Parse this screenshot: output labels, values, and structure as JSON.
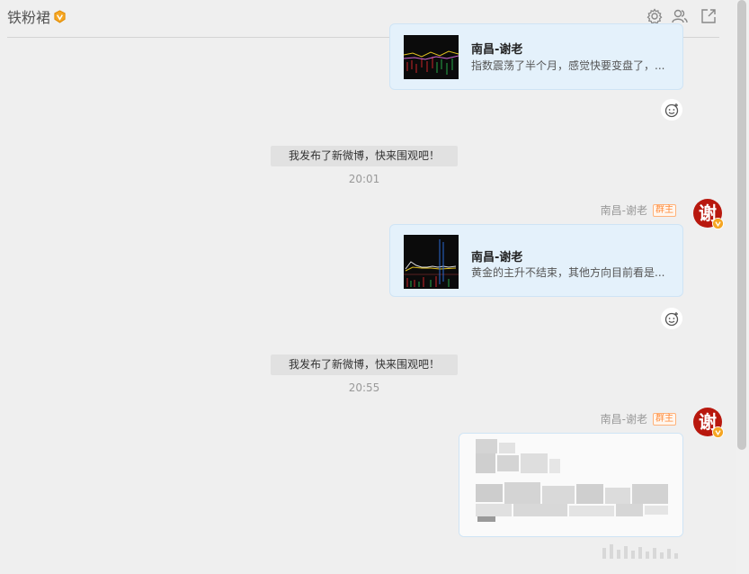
{
  "header": {
    "title": "铁粉裙",
    "icons": [
      "vip-badge-icon",
      "gear-icon",
      "members-icon",
      "external-link-icon"
    ]
  },
  "messages": [
    {
      "type": "weibo_card",
      "author": "南昌-谢老",
      "desc": "指数震荡了半个月，感觉快要变盘了，..."
    },
    {
      "type": "system",
      "text": "我发布了新微博，快来围观吧！",
      "time": "20:01"
    },
    {
      "type": "weibo_card",
      "sender": "南昌-谢老",
      "badge": "群主",
      "avatar_char": "谢",
      "author": "南昌-谢老",
      "desc": "黄金的主升不结束，其他方向目前看是..."
    },
    {
      "type": "system",
      "text": "我发布了新微博，快来围观吧！",
      "time": "20:55"
    },
    {
      "type": "image",
      "sender": "南昌-谢老",
      "badge": "群主",
      "avatar_char": "谢"
    }
  ],
  "colors": {
    "background": "#efefef",
    "card_bg": "#e4f1fb",
    "owner_badge": "#ff8c3c",
    "avatar_red": "#b8180e",
    "vip_orange": "#f5a623"
  }
}
